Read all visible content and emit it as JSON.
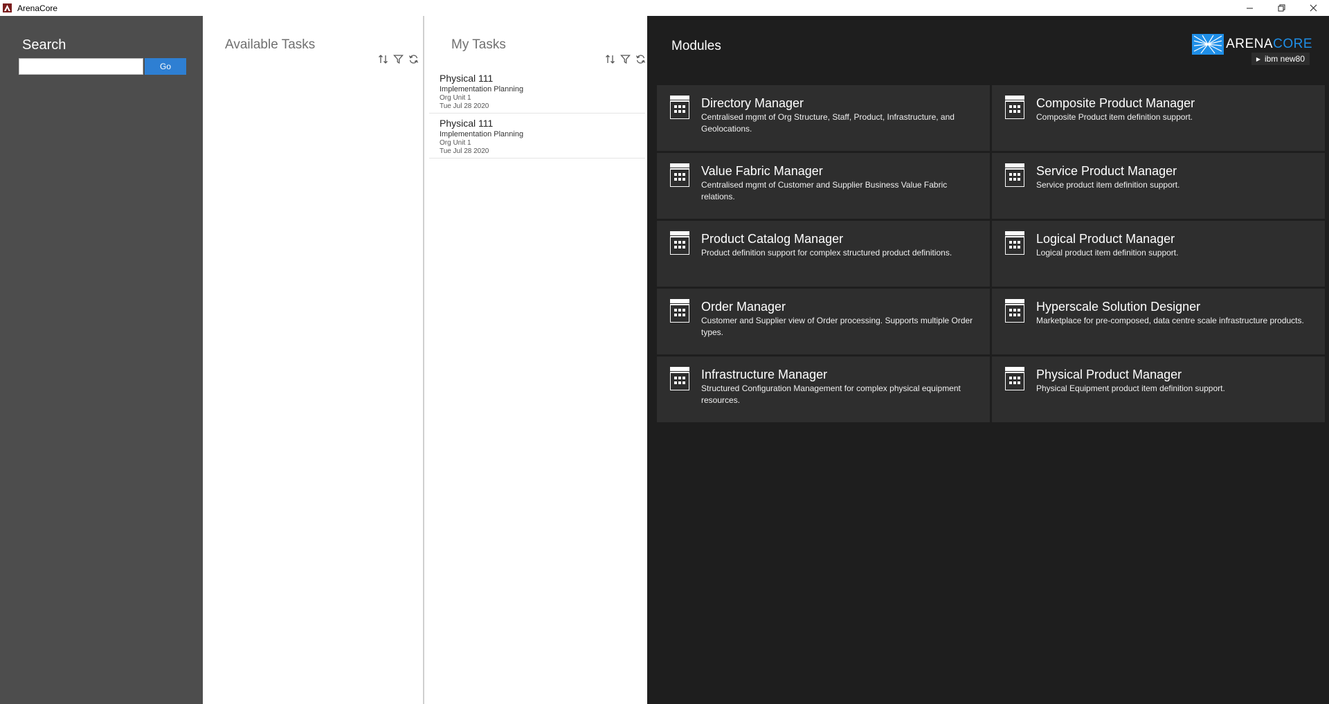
{
  "window": {
    "title": "ArenaCore",
    "controls": [
      "minimize-icon",
      "restore-icon",
      "close-icon"
    ]
  },
  "search": {
    "title": "Search",
    "input_value": "",
    "go_label": "Go"
  },
  "available_tasks": {
    "title": "Available Tasks",
    "tools": [
      "sort-icon",
      "filter-icon",
      "refresh-icon"
    ],
    "items": []
  },
  "my_tasks": {
    "title": "My Tasks",
    "tools": [
      "sort-icon",
      "filter-icon",
      "refresh-icon"
    ],
    "items": [
      {
        "name": "Physical 111",
        "stage": "Implementation Planning",
        "org": "Org Unit 1",
        "date": "Tue Jul 28 2020"
      },
      {
        "name": "Physical 111",
        "stage": "Implementation Planning",
        "org": "Org Unit 1",
        "date": "Tue Jul 28 2020"
      }
    ]
  },
  "modules": {
    "title": "Modules",
    "brand": {
      "name_part1": "ARENA",
      "name_part2": "CORE",
      "accent_color": "#1f8fe8"
    },
    "user": "ibm new80",
    "items": [
      {
        "name": "Directory Manager",
        "description": "Centralised mgmt of Org Structure, Staff, Product, Infrastructure, and Geolocations."
      },
      {
        "name": "Composite Product Manager",
        "description": "Composite Product item definition support."
      },
      {
        "name": "Value Fabric Manager",
        "description": "Centralised mgmt of Customer and Supplier Business Value Fabric relations."
      },
      {
        "name": "Service Product Manager",
        "description": "Service product item definition support."
      },
      {
        "name": "Product Catalog Manager",
        "description": "Product definition support for complex structured product definitions."
      },
      {
        "name": "Logical Product Manager",
        "description": "Logical product item definition support."
      },
      {
        "name": "Order Manager",
        "description": "Customer and Supplier view of Order processing. Supports multiple Order types."
      },
      {
        "name": "Hyperscale Solution Designer",
        "description": "Marketplace for pre-composed, data centre scale infrastructure products."
      },
      {
        "name": "Infrastructure Manager",
        "description": "Structured Configuration Management for complex physical equipment resources."
      },
      {
        "name": "Physical Product Manager",
        "description": "Physical Equipment product item definition support."
      }
    ]
  },
  "colors": {
    "search_bg": "#4d4d4d",
    "go_button": "#2e7fd3",
    "modules_bg": "#1e1e1e",
    "tile_bg": "#2e2e2e"
  }
}
